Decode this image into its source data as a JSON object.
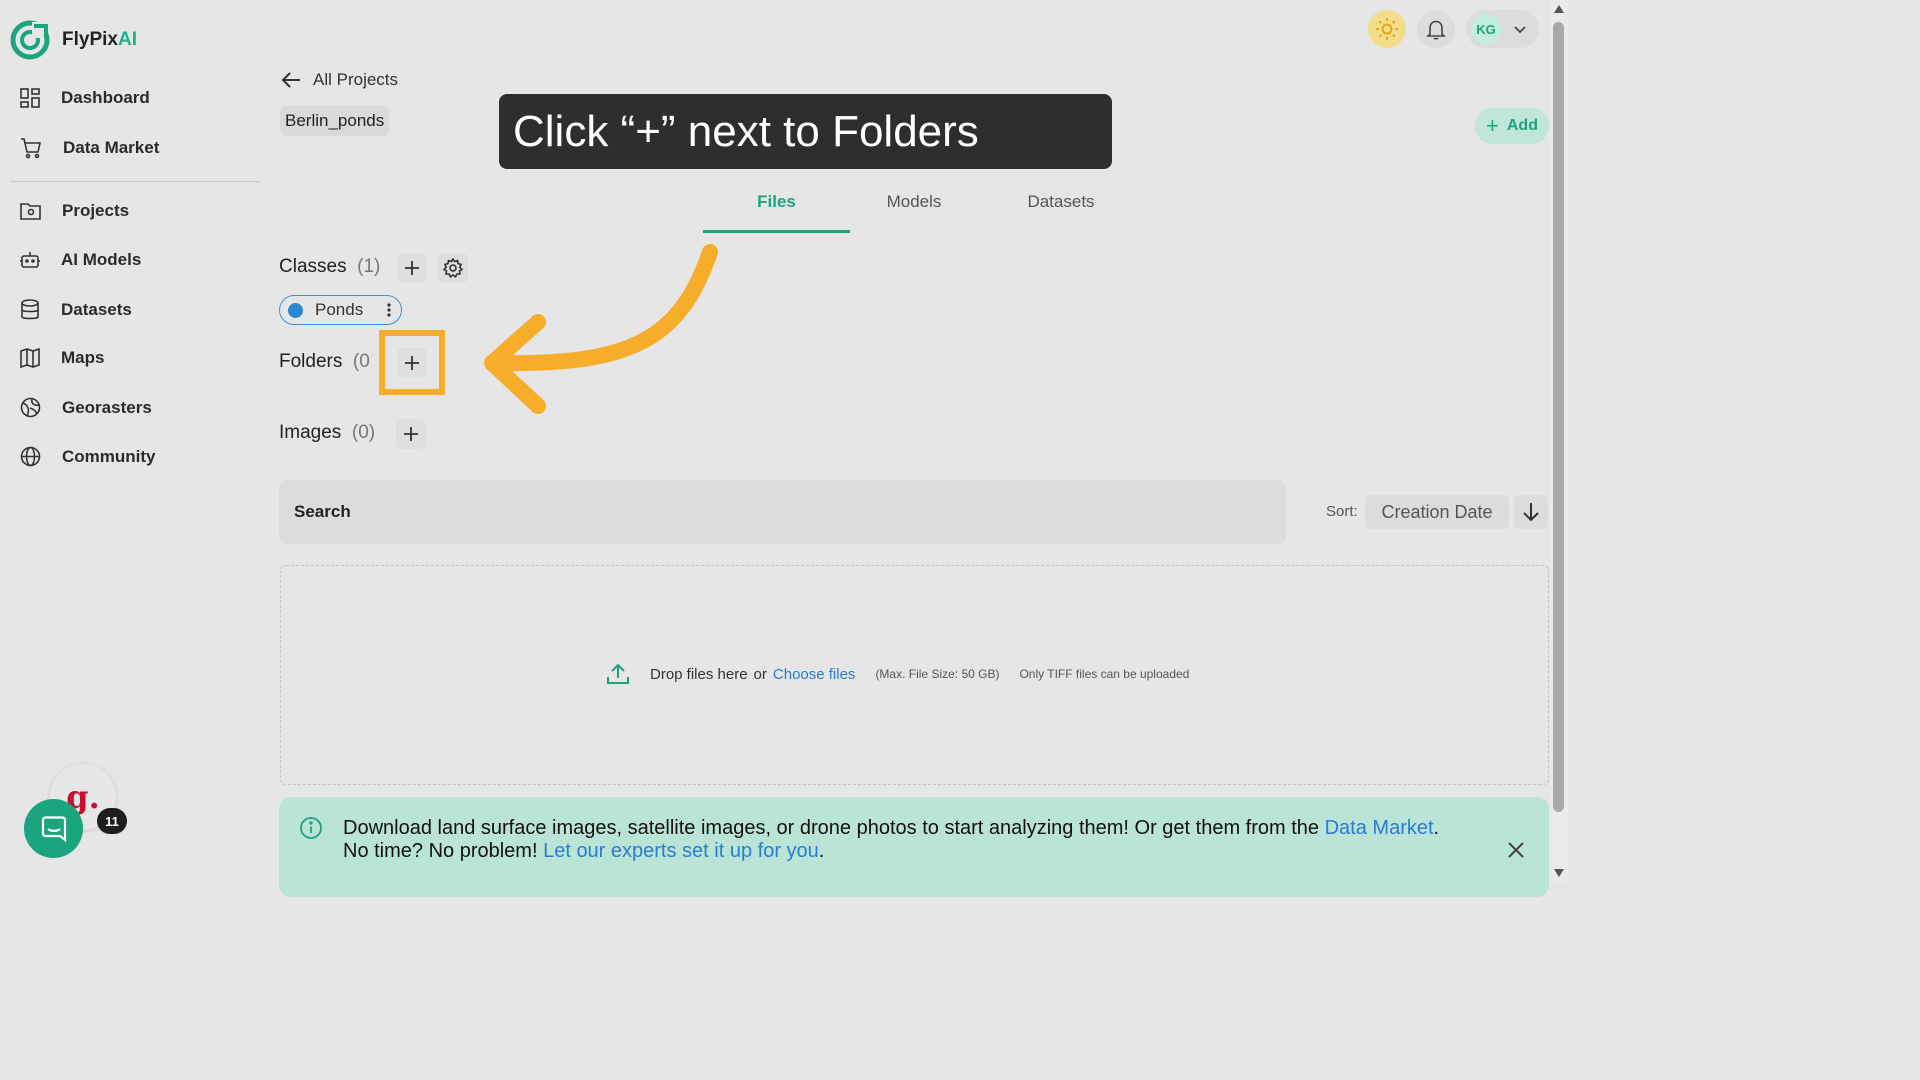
{
  "brand": {
    "name_prefix": "FlyPix",
    "name_suffix": "AI"
  },
  "sidebar": {
    "items": [
      {
        "label": "Dashboard",
        "icon": "dashboard-icon"
      },
      {
        "label": "Data Market",
        "icon": "cart-icon"
      },
      {
        "label": "Projects",
        "icon": "folder-icon"
      },
      {
        "label": "AI Models",
        "icon": "robot-icon"
      },
      {
        "label": "Datasets",
        "icon": "database-icon"
      },
      {
        "label": "Maps",
        "icon": "map-icon"
      },
      {
        "label": "Georasters",
        "icon": "globe-grid-icon"
      },
      {
        "label": "Community",
        "icon": "globe-icon"
      }
    ]
  },
  "header": {
    "avatar_initials": "KG",
    "add_label": "Add"
  },
  "breadcrumb": {
    "back_label": "All Projects",
    "project_name": "Berlin_ponds"
  },
  "tooltip": {
    "text": "Click “+” next to Folders"
  },
  "tabs": [
    {
      "label": "Files",
      "active": true
    },
    {
      "label": "Models"
    },
    {
      "label": "Datasets"
    }
  ],
  "classes": {
    "title": "Classes",
    "count": "(1)",
    "items": [
      {
        "label": "Ponds",
        "color": "#2a87d6"
      }
    ]
  },
  "folders": {
    "title": "Folders",
    "count": "(0"
  },
  "images": {
    "title": "Images",
    "count": "(0)"
  },
  "search": {
    "placeholder": "Search"
  },
  "sort": {
    "label": "Sort:",
    "value": "Creation Date"
  },
  "dropzone": {
    "text": "Drop files here",
    "or": "or",
    "choose": "Choose files",
    "max_size": "(Max. File Size: 50 GB)",
    "only_tiff": "Only TIFF files can be uploaded"
  },
  "banner": {
    "text1": "Download land surface images, satellite images, or drone photos to start analyzing them! Or get them from the ",
    "link1": "Data Market",
    "text2": ".",
    "text3": "No time? No problem! ",
    "link2": "Let our experts set it up for you",
    "text4": "."
  },
  "widgets": {
    "g_letter": "g.",
    "badge_count": "11"
  },
  "colors": {
    "accent": "#1aa57f",
    "highlight": "#f6ad2a",
    "link": "#2a7bd6"
  }
}
